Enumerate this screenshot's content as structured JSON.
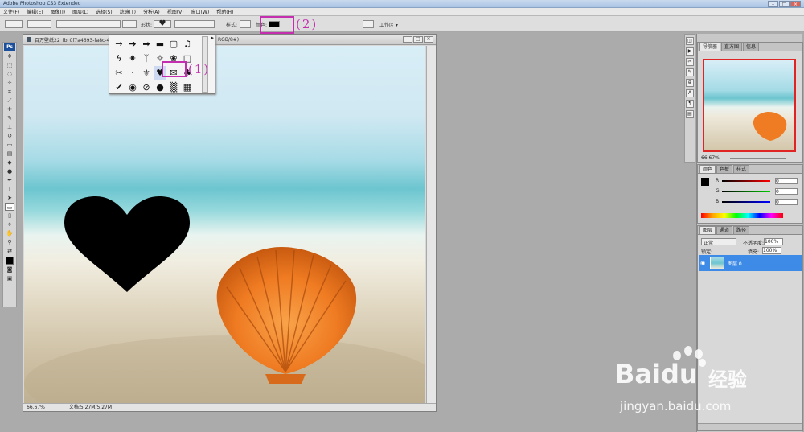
{
  "app": {
    "title": "Adobe Photoshop CS3 Extended"
  },
  "menu": [
    "文件(F)",
    "编辑(E)",
    "图像(I)",
    "图层(L)",
    "选择(S)",
    "滤镜(T)",
    "分析(A)",
    "视图(V)",
    "窗口(W)",
    "帮助(H)"
  ],
  "options": {
    "shape_label": "形状:",
    "style_label": "样式:",
    "color_label": "颜色:",
    "workspace_label": "工作区 ▾"
  },
  "annotations": {
    "one": "(1)",
    "two": "(2)"
  },
  "document": {
    "title": "百万壁纸22_fb_0f7a4693-fa8c-4",
    "mode": "RGB/8#)",
    "zoom": "66.67%",
    "doc_size": "文档:5.27M/5.27M"
  },
  "navigator": {
    "tabs": [
      "导航器",
      "直方图",
      "信息"
    ],
    "zoom": "66.67%"
  },
  "color_panel": {
    "tabs": [
      "颜色",
      "色板",
      "样式"
    ],
    "r": "R",
    "g": "G",
    "b": "B",
    "r_val": "0",
    "g_val": "0",
    "b_val": "0"
  },
  "layers": {
    "tabs": [
      "图层",
      "通道",
      "路径"
    ],
    "blend": "正常",
    "opacity_label": "不透明度:",
    "opacity": "100%",
    "lock_label": "锁定:",
    "fill_label": "填充:",
    "fill": "100%",
    "layer_name": "图层 0"
  },
  "watermark": {
    "brand": "Baidu",
    "cn": "经验",
    "url": "jingyan.baidu.com"
  },
  "colors": {
    "annotation": "#c42fb0",
    "layer_selected": "#3d8be6"
  }
}
